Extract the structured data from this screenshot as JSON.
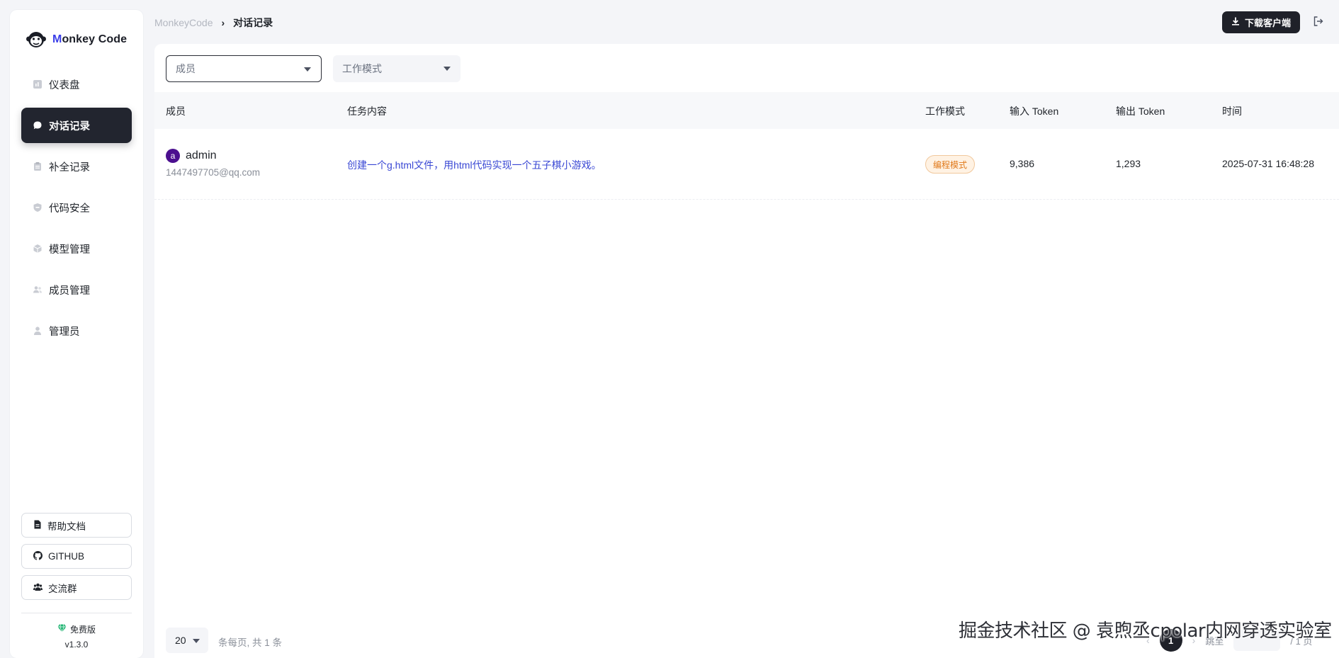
{
  "app": {
    "logo_prefix": "M",
    "logo_rest": "onkey Code",
    "accent": "#3a3ee8"
  },
  "sidebar": {
    "items": [
      {
        "label": "仪表盘",
        "icon": "dashboard-icon"
      },
      {
        "label": "对话记录",
        "icon": "chat-icon",
        "active": true
      },
      {
        "label": "补全记录",
        "icon": "clipboard-icon"
      },
      {
        "label": "代码安全",
        "icon": "shield-icon"
      },
      {
        "label": "模型管理",
        "icon": "cube-icon"
      },
      {
        "label": "成员管理",
        "icon": "users-icon"
      },
      {
        "label": "管理员",
        "icon": "admin-icon"
      }
    ],
    "links": [
      {
        "label": "帮助文档",
        "icon": "document-icon"
      },
      {
        "label": "GITHUB",
        "icon": "github-icon"
      },
      {
        "label": "交流群",
        "icon": "group-icon"
      }
    ],
    "plan": "免费版",
    "version": "v1.3.0"
  },
  "header": {
    "breadcrumb_home": "MonkeyCode",
    "breadcrumb_current": "对话记录",
    "download_label": "下载客户端"
  },
  "filters": {
    "member_placeholder": "成员",
    "mode_placeholder": "工作模式"
  },
  "table": {
    "columns": [
      "成员",
      "任务内容",
      "工作模式",
      "输入 Token",
      "输出 Token",
      "时间"
    ],
    "rows": [
      {
        "avatar_letter": "a",
        "user": "admin",
        "email": "1447497705@qq.com",
        "task": "创建一个g.html文件，用html代码实现一个五子棋小游戏。",
        "mode": "编程模式",
        "input_tokens": "9,386",
        "output_tokens": "1,293",
        "time": "2025-07-31 16:48:28"
      }
    ]
  },
  "pagination": {
    "page_size": "20",
    "info": "条每页, 共 1 条",
    "current_page": "1",
    "goto_label": "跳至",
    "total_pages": "/ 1 页"
  },
  "watermark": "掘金技术社区 @ 袁煦丞cpolar内网穿透实验室"
}
